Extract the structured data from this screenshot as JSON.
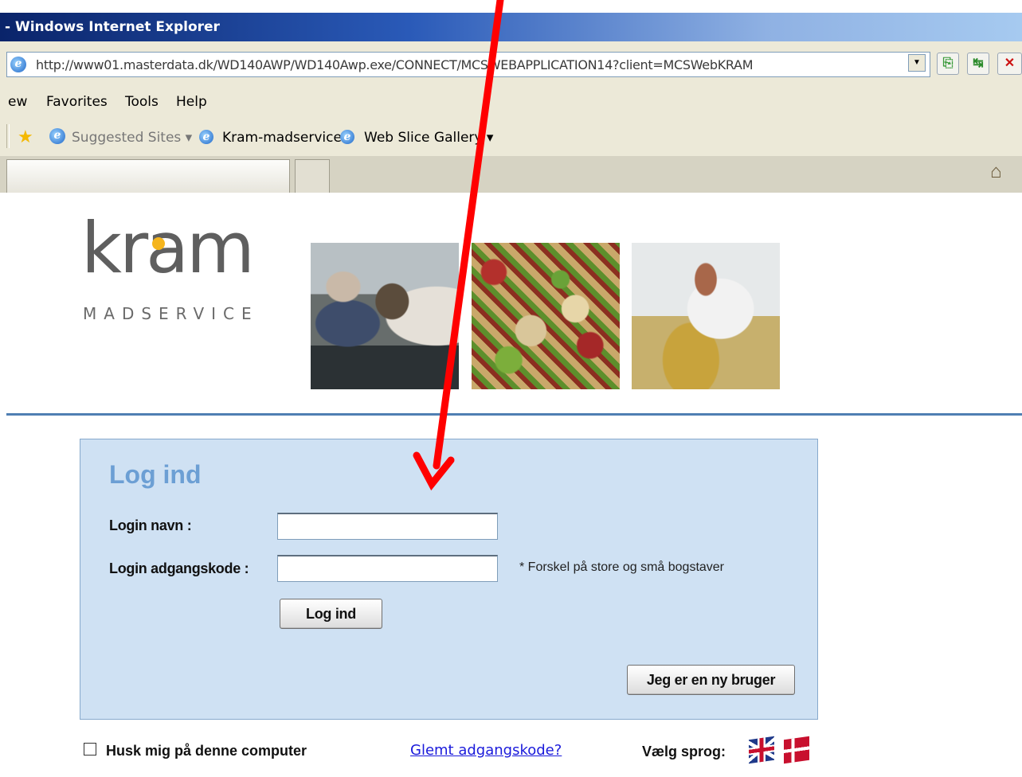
{
  "browser": {
    "title": "- Windows Internet Explorer",
    "url": "http://www01.masterdata.dk/WD140AWP/WD140Awp.exe/CONNECT/MCSWEBAPPLICATION14?client=MCSWebKRAM",
    "menu": [
      "ew",
      "Favorites",
      "Tools",
      "Help"
    ],
    "favorites": {
      "suggested": "Suggested Sites ▾",
      "item1": "Kram-madservice",
      "item2": "Web Slice Gallery ▾"
    },
    "icons": [
      "ie-icon",
      "compat-view-icon",
      "refresh-icon",
      "stop-icon",
      "favorites-star-icon",
      "home-icon"
    ]
  },
  "brand": {
    "logo_text": "kram",
    "logo_sub": "MADSERVICE",
    "accent_color": "#f5b51d",
    "text_color": "#5f5f5f"
  },
  "login": {
    "title": "Log ind",
    "username_label": "Login navn :",
    "username_value": "",
    "password_label": "Login adgangskode :",
    "password_value": "",
    "case_note": "* Forskel på store og små bogstaver",
    "submit_label": "Log ind",
    "new_user_label": "Jeg er en ny bruger",
    "panel_color": "#cfe1f3",
    "title_color": "#6c9fd4"
  },
  "footer": {
    "remember_label": "Husk mig på denne computer",
    "remember_checked": false,
    "forgot_label": "Glemt adgangskode?",
    "language_label": "Vælg sprog:",
    "languages": [
      "english-flag-icon",
      "danish-flag-icon"
    ]
  },
  "annotation": {
    "arrow_color": "#ff0000"
  }
}
